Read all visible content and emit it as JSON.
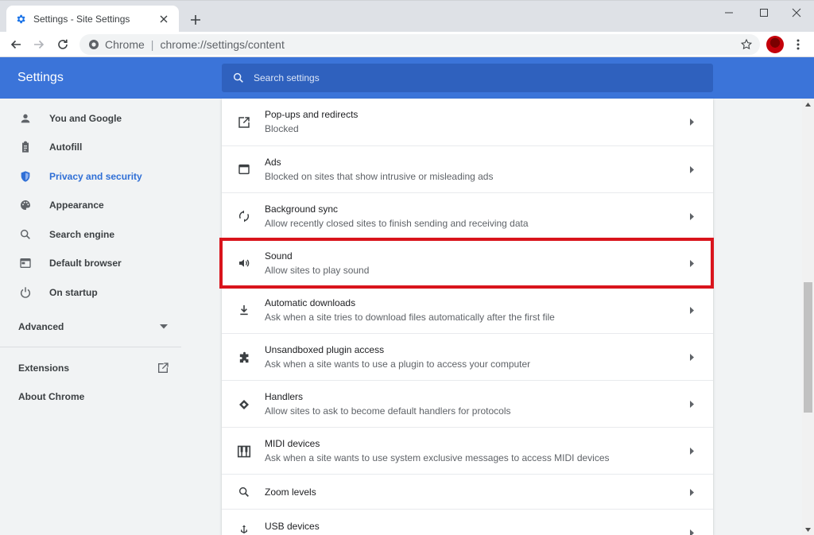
{
  "colors": {
    "accent": "#3b74d9",
    "active_nav": "#2f6fd6",
    "highlight_border": "#d9141c"
  },
  "tab": {
    "title": "Settings - Site Settings",
    "favicon": "gear-icon",
    "close_icon": "close-icon"
  },
  "window_controls": [
    "minimize-icon",
    "maximize-icon",
    "close-icon"
  ],
  "toolbar": {
    "chip": "Chrome",
    "url": "chrome://settings/content",
    "separator": "|"
  },
  "header": {
    "title": "Settings",
    "search_placeholder": "Search settings"
  },
  "sidebar": {
    "items": [
      {
        "label": "You and Google",
        "icon": "person-icon",
        "active": false
      },
      {
        "label": "Autofill",
        "icon": "clipboard-icon",
        "active": false
      },
      {
        "label": "Privacy and security",
        "icon": "shield-icon",
        "active": true
      },
      {
        "label": "Appearance",
        "icon": "palette-icon",
        "active": false
      },
      {
        "label": "Search engine",
        "icon": "search-icon",
        "active": false
      },
      {
        "label": "Default browser",
        "icon": "browser-window-icon",
        "active": false
      },
      {
        "label": "On startup",
        "icon": "power-icon",
        "active": false
      }
    ],
    "advanced_label": "Advanced",
    "extensions_label": "Extensions",
    "about_label": "About Chrome"
  },
  "content": {
    "rows": [
      {
        "title": "Pop-ups and redirects",
        "subtitle": "Blocked",
        "icon": "open-in-new-icon"
      },
      {
        "title": "Ads",
        "subtitle": "Blocked on sites that show intrusive or misleading ads",
        "icon": "window-icon"
      },
      {
        "title": "Background sync",
        "subtitle": "Allow recently closed sites to finish sending and receiving data",
        "icon": "sync-icon"
      },
      {
        "title": "Sound",
        "subtitle": "Allow sites to play sound",
        "icon": "volume-icon",
        "highlighted": true
      },
      {
        "title": "Automatic downloads",
        "subtitle": "Ask when a site tries to download files automatically after the first file",
        "icon": "download-icon"
      },
      {
        "title": "Unsandboxed plugin access",
        "subtitle": "Ask when a site wants to use a plugin to access your computer",
        "icon": "puzzle-icon"
      },
      {
        "title": "Handlers",
        "subtitle": "Allow sites to ask to become default handlers for protocols",
        "icon": "handler-diamond-icon"
      },
      {
        "title": "MIDI devices",
        "subtitle": "Ask when a site wants to use system exclusive messages to access MIDI devices",
        "icon": "piano-keys-icon"
      },
      {
        "title": "Zoom levels",
        "subtitle": "",
        "icon": "zoom-icon"
      },
      {
        "title": "USB devices",
        "subtitle": "",
        "icon": "usb-icon"
      }
    ]
  }
}
